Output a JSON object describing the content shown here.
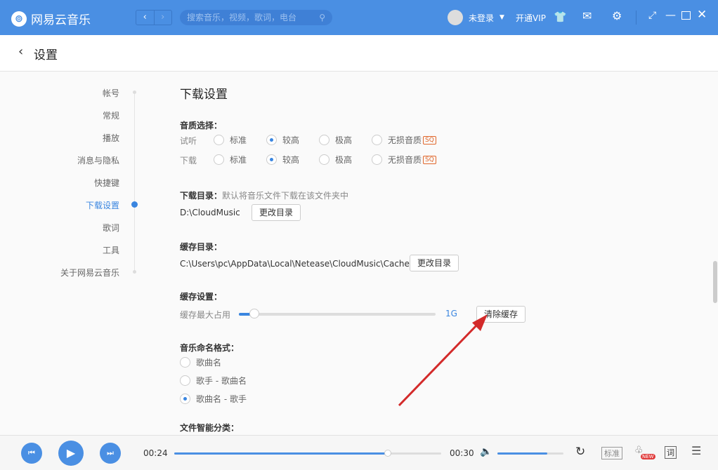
{
  "header": {
    "app_name": "网易云音乐",
    "search_placeholder": "搜索音乐，视频，歌词，电台",
    "user": "未登录",
    "vip": "开通VIP"
  },
  "page": {
    "title": "设置"
  },
  "sidebar": {
    "items": [
      "帐号",
      "常规",
      "播放",
      "消息与隐私",
      "快捷键",
      "下载设置",
      "歌词",
      "工具",
      "关于网易云音乐"
    ],
    "active": 5
  },
  "content": {
    "section_title": "下载设置",
    "quality": {
      "label": "音质选择：",
      "rows": [
        {
          "name": "试听",
          "options": [
            "标准",
            "较高",
            "极高",
            "无损音质"
          ],
          "selected": 1
        },
        {
          "name": "下载",
          "options": [
            "标准",
            "较高",
            "极高",
            "无损音质"
          ],
          "selected": 1
        }
      ],
      "badge": "SQ"
    },
    "download_dir": {
      "label": "下载目录：",
      "hint": "默认将音乐文件下载在该文件夹中",
      "path": "D:\\CloudMusic",
      "button": "更改目录"
    },
    "cache_dir": {
      "label": "缓存目录：",
      "path": "C:\\Users\\pc\\AppData\\Local\\Netease\\CloudMusic\\Cache",
      "button": "更改目录"
    },
    "cache": {
      "label": "缓存设置：",
      "max_label": "缓存最大占用",
      "value": "1G",
      "button": "清除缓存",
      "fraction": 0.08
    },
    "naming": {
      "label": "音乐命名格式：",
      "options": [
        "歌曲名",
        "歌手 - 歌曲名",
        "歌曲名 - 歌手"
      ],
      "selected": 2
    },
    "classify": {
      "label": "文件智能分类："
    }
  },
  "player": {
    "elapsed": "00:24",
    "total": "00:30",
    "progress": 0.8,
    "volume": 0.75,
    "quality": "标准",
    "new_badge": "NEW",
    "lyrics": "词"
  },
  "colors": {
    "accent": "#4a8fe3",
    "arrow": "#d32a2a"
  }
}
